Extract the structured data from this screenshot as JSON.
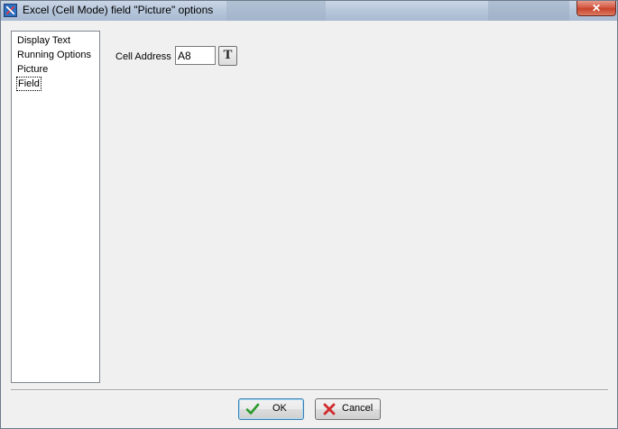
{
  "window": {
    "title": "Excel (Cell Mode) field \"Picture\" options",
    "close_symbol": "✕",
    "app_icon": "app-icon"
  },
  "sidebar": {
    "items": [
      {
        "label": "Display Text",
        "selected": false
      },
      {
        "label": "Running Options",
        "selected": false
      },
      {
        "label": "Picture",
        "selected": false
      },
      {
        "label": "Field",
        "selected": true
      }
    ]
  },
  "field": {
    "cell_address_label": "Cell Address",
    "cell_address_value": "A8",
    "text_button_label": "T"
  },
  "buttons": {
    "ok_label": "OK",
    "ok_icon": "checkmark-icon",
    "cancel_label": "Cancel",
    "cancel_icon": "x-icon"
  },
  "colors": {
    "checkmark": "#2b9a2b",
    "cancel_x": "#d22b2b"
  }
}
